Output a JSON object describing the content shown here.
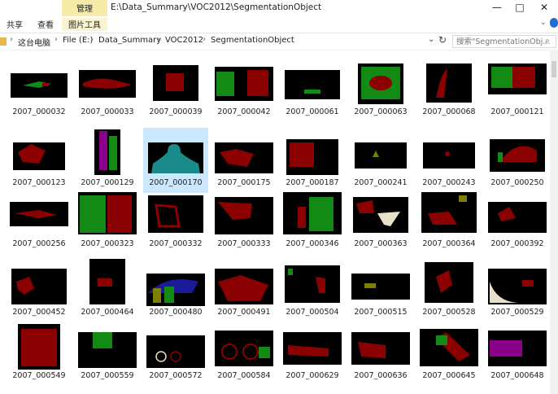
{
  "window": {
    "path_title": "E:\\Data_Summary\\VOC2012\\SegmentationObject",
    "context_group": "管理",
    "context_tab": "图片工具",
    "tabs": [
      "共享",
      "查看"
    ],
    "controls": [
      "—",
      "□",
      "✕"
    ]
  },
  "address": {
    "crumbs": [
      "这台电脑",
      "File (E:)",
      "Data_Summary",
      "VOC2012",
      "SegmentationObject"
    ],
    "search_placeholder": "搜索\"SegmentationObj..."
  },
  "files": [
    {
      "name": "2007_000032"
    },
    {
      "name": "2007_000033"
    },
    {
      "name": "2007_000039"
    },
    {
      "name": "2007_000042"
    },
    {
      "name": "2007_000061"
    },
    {
      "name": "2007_000063"
    },
    {
      "name": "2007_000068"
    },
    {
      "name": "2007_000121"
    },
    {
      "name": "2007_000123"
    },
    {
      "name": "2007_000129"
    },
    {
      "name": "2007_000170"
    },
    {
      "name": "2007_000175"
    },
    {
      "name": "2007_000187"
    },
    {
      "name": "2007_000241"
    },
    {
      "name": "2007_000243"
    },
    {
      "name": "2007_000250"
    },
    {
      "name": "2007_000256"
    },
    {
      "name": "2007_000323"
    },
    {
      "name": "2007_000332"
    },
    {
      "name": "2007_000333"
    },
    {
      "name": "2007_000346"
    },
    {
      "name": "2007_000363"
    },
    {
      "name": "2007_000364"
    },
    {
      "name": "2007_000392"
    },
    {
      "name": "2007_000452"
    },
    {
      "name": "2007_000464"
    },
    {
      "name": "2007_000480"
    },
    {
      "name": "2007_000491"
    },
    {
      "name": "2007_000504"
    },
    {
      "name": "2007_000515"
    },
    {
      "name": "2007_000528"
    },
    {
      "name": "2007_000529"
    },
    {
      "name": "2007_000549"
    },
    {
      "name": "2007_000559"
    },
    {
      "name": "2007_000572"
    },
    {
      "name": "2007_000584"
    },
    {
      "name": "2007_000629"
    },
    {
      "name": "2007_000636"
    },
    {
      "name": "2007_000645"
    },
    {
      "name": "2007_000648"
    }
  ],
  "selected_file": "2007_000170",
  "colors": {
    "mask_bg": "#000000",
    "red": "#8b0000",
    "green": "#138a13",
    "teal": "#1a8a8a",
    "olive": "#7f7f00",
    "purple": "#8b008b",
    "blue": "#1a1a9a",
    "cream": "#e8e0c8",
    "highlight": "#cce8ff"
  }
}
